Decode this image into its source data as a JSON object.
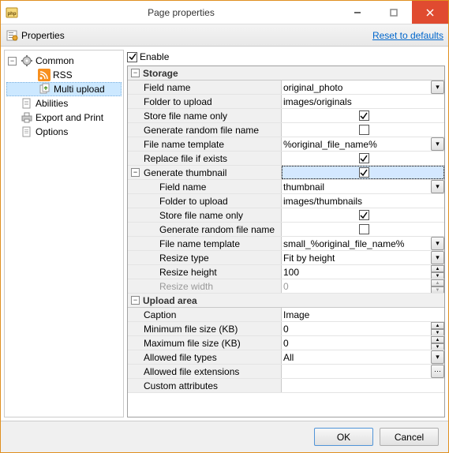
{
  "window": {
    "title": "Page properties"
  },
  "toolbar": {
    "properties": "Properties",
    "reset": "Reset to defaults"
  },
  "tree": {
    "common": "Common",
    "rss": "RSS",
    "multi_upload": "Multi upload",
    "abilities": "Abilities",
    "export_print": "Export and Print",
    "options": "Options"
  },
  "enable_label": "Enable",
  "enable_checked": true,
  "sections": {
    "storage": "Storage",
    "gen_thumb": "Generate thumbnail",
    "upload_area": "Upload area"
  },
  "labels": {
    "field_name": "Field name",
    "folder_upload": "Folder to upload",
    "store_fn_only": "Store file name only",
    "gen_random": "Generate random file name",
    "fn_template": "File name template",
    "replace_if_exists": "Replace file if exists",
    "resize_type": "Resize type",
    "resize_height": "Resize height",
    "resize_width": "Resize width",
    "caption": "Caption",
    "min_size": "Minimum file size (KB)",
    "max_size": "Maximum file size (KB)",
    "allowed_types": "Allowed file types",
    "allowed_ext": "Allowed file extensions",
    "custom_attrs": "Custom attributes"
  },
  "values": {
    "field_name": "original_photo",
    "folder_upload": "images/originals",
    "store_fn_only": true,
    "gen_random": false,
    "fn_template": "%original_file_name%",
    "replace_if_exists": true,
    "gen_thumb": true,
    "t_field_name": "thumbnail",
    "t_folder_upload": "images/thumbnails",
    "t_store_fn_only": true,
    "t_gen_random": false,
    "t_fn_template": "small_%original_file_name%",
    "t_resize_type": "Fit by height",
    "t_resize_height": "100",
    "t_resize_width": "0",
    "ua_caption": "Image",
    "ua_min_size": "0",
    "ua_max_size": "0",
    "ua_allowed_types": "All",
    "ua_allowed_ext": "",
    "ua_custom_attrs": ""
  },
  "buttons": {
    "ok": "OK",
    "cancel": "Cancel"
  }
}
